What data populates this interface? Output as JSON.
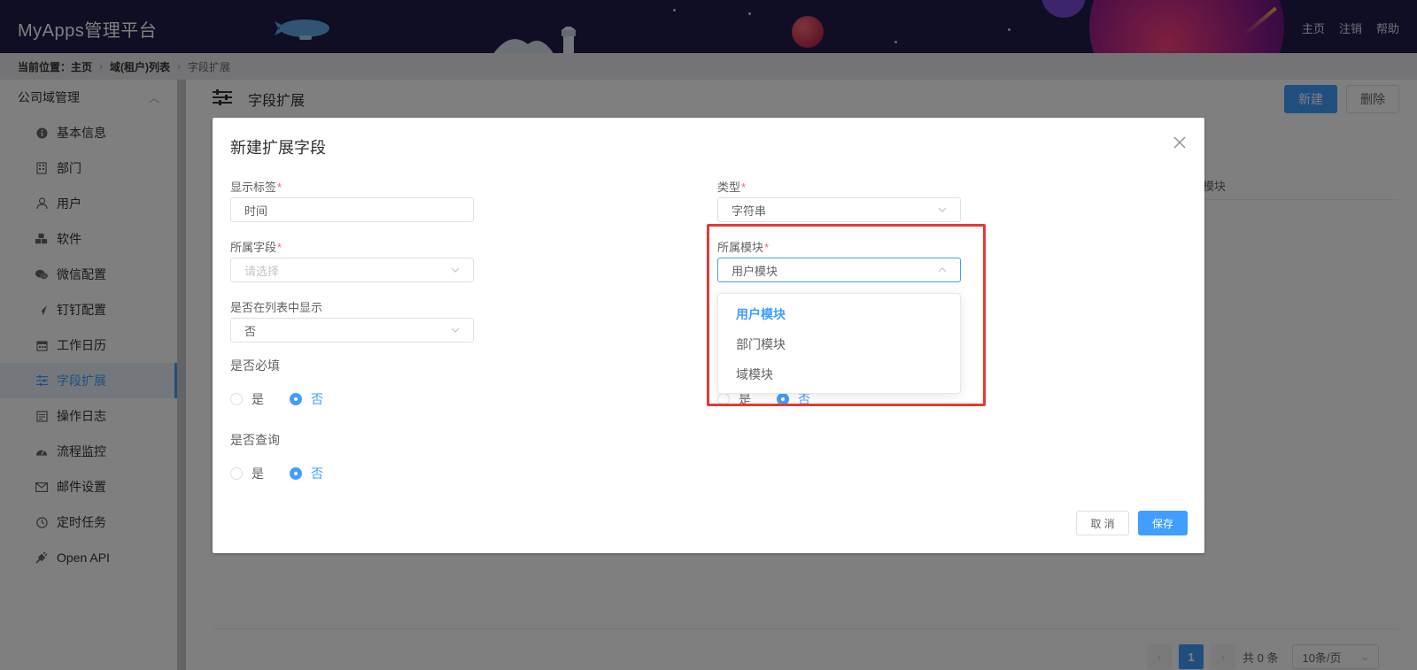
{
  "header": {
    "app_title": "MyApps管理平台",
    "nav": [
      "主页",
      "注销",
      "帮助"
    ]
  },
  "breadcrumb": {
    "prefix": "当前位置：主页",
    "items": [
      "域(租户)列表",
      "字段扩展"
    ]
  },
  "sidebar": {
    "group_label": "公司域管理",
    "items": [
      {
        "label": "基本信息",
        "icon": "info-icon"
      },
      {
        "label": "部门",
        "icon": "building-icon"
      },
      {
        "label": "用户",
        "icon": "user-icon"
      },
      {
        "label": "软件",
        "icon": "cubes-icon"
      },
      {
        "label": "微信配置",
        "icon": "wechat-icon"
      },
      {
        "label": "钉钉配置",
        "icon": "plane-icon"
      },
      {
        "label": "工作日历",
        "icon": "calendar-icon"
      },
      {
        "label": "字段扩展",
        "icon": "sliders-icon",
        "active": true
      },
      {
        "label": "操作日志",
        "icon": "log-icon"
      },
      {
        "label": "流程监控",
        "icon": "dashboard-icon"
      },
      {
        "label": "邮件设置",
        "icon": "mail-icon"
      },
      {
        "label": "定时任务",
        "icon": "clock-icon"
      },
      {
        "label": "Open API",
        "icon": "plug-icon"
      }
    ]
  },
  "page": {
    "title": "字段扩展",
    "new_label": "新建",
    "delete_label": "删除",
    "column_partial": "模块",
    "pager": {
      "current": "1",
      "total_text": "共 0 条",
      "page_size": "10条/页"
    }
  },
  "dialog": {
    "title": "新建扩展字段",
    "fields": {
      "display_label": {
        "label": "显示标签",
        "value": "时间"
      },
      "type": {
        "label": "类型",
        "value": "字符串"
      },
      "field": {
        "label": "所属字段",
        "placeholder": "请选择"
      },
      "module": {
        "label": "所属模块",
        "value": "用户模块"
      },
      "show_in_list": {
        "label": "是否在列表中显示",
        "value": "否"
      },
      "required": {
        "label": "是否必填",
        "yes": "是",
        "no": "否",
        "selected": "否"
      },
      "query": {
        "label": "是否查询",
        "yes": "是",
        "no": "否",
        "selected": "否"
      },
      "right_radio": {
        "yes": "是",
        "no": "否"
      }
    },
    "module_options": [
      "用户模块",
      "部门模块",
      "域模块"
    ],
    "cancel_label": "取 消",
    "save_label": "保存"
  },
  "colors": {
    "accent": "#409eff",
    "header_bg": "#1e1c49",
    "highlight": "#e53935"
  }
}
